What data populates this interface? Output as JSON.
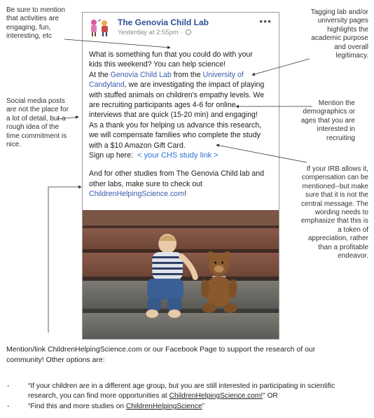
{
  "notes": {
    "top_left": [
      "Be sure to mention",
      "that activities are",
      "engaging, fun,",
      "interesting, etc"
    ],
    "left_middle": [
      "Social media posts",
      "are not the place for",
      "a lot of detail, but a",
      "rough idea of the",
      "time commitment is",
      "nice."
    ],
    "top_right": [
      "Tagging lab and/or",
      "university pages",
      "highlights the",
      "academic purpose",
      "and overall",
      "legitimacy."
    ],
    "right_middle": [
      "Mention the",
      "demographics or",
      "ages that you are",
      "interested in",
      "recruiting"
    ],
    "right_lower": [
      "If your IRB allows it,",
      "compensation can be",
      "mentioned--but make",
      "sure that it is not the",
      "central message. The",
      "wording needs to",
      "emphasize that this is",
      "a token of",
      "appreciation, rather",
      "than a profitable",
      "endeavor."
    ]
  },
  "post": {
    "page_name": "The Genovia Child Lab",
    "timestamp": "Yesterday at 2:55pm ·",
    "more_icon": "more-horizontal-icon",
    "line1": "What is something fun that you could do with your",
    "line2": "kids this weekend? You can help science!",
    "line3_a": "At the ",
    "line3_link1": "Genovia Child Lab",
    "line3_b": " from the ",
    "line3_link2": "University of",
    "line4_link2": "Candyland",
    "line4_b": ", we are investigating the impact of playing",
    "line5": "with stuffed animals on children's empathy levels. We",
    "line6": "are recruiting participants ages 4-6 for online",
    "line7": "interviews that are quick (15-20 min) and engaging!",
    "line8": "As a thank you for helping us advance this research,",
    "line9": "we will compensate families who complete the study",
    "line10": "with a $10 Amazon Gift Card.",
    "signup_label": "Sign up here:",
    "signup_link": "< your CHS study link >",
    "line11": "And for other studies from The Genovia Child lab and",
    "line12": "other labs, make sure to check out",
    "line13_link": "ChildrenHelpingScience.com",
    "line13_end": "!"
  },
  "bottom": {
    "line1": "Mention/link ChildrenHelpingScience.com or our Facebook Page to support the research of our",
    "line2": "community! Other options are:",
    "bullet_dash": "-",
    "bullet1_a": "“If your children are in a different age group, but you are still interested in participating in scientific",
    "bullet1_b": "research, you can find more opportunities at ",
    "bullet1_link": "ChildrenHelpingScience.com!",
    "bullet1_end": "” OR",
    "bullet2_a": "“Find this and more studies on ",
    "bullet2_link": "ChildrenHelpingScience",
    "bullet2_end": "”"
  },
  "colors": {
    "link": "#3b5bb0",
    "page_name": "#2f4f9a",
    "cta": "#2f6fd6"
  }
}
